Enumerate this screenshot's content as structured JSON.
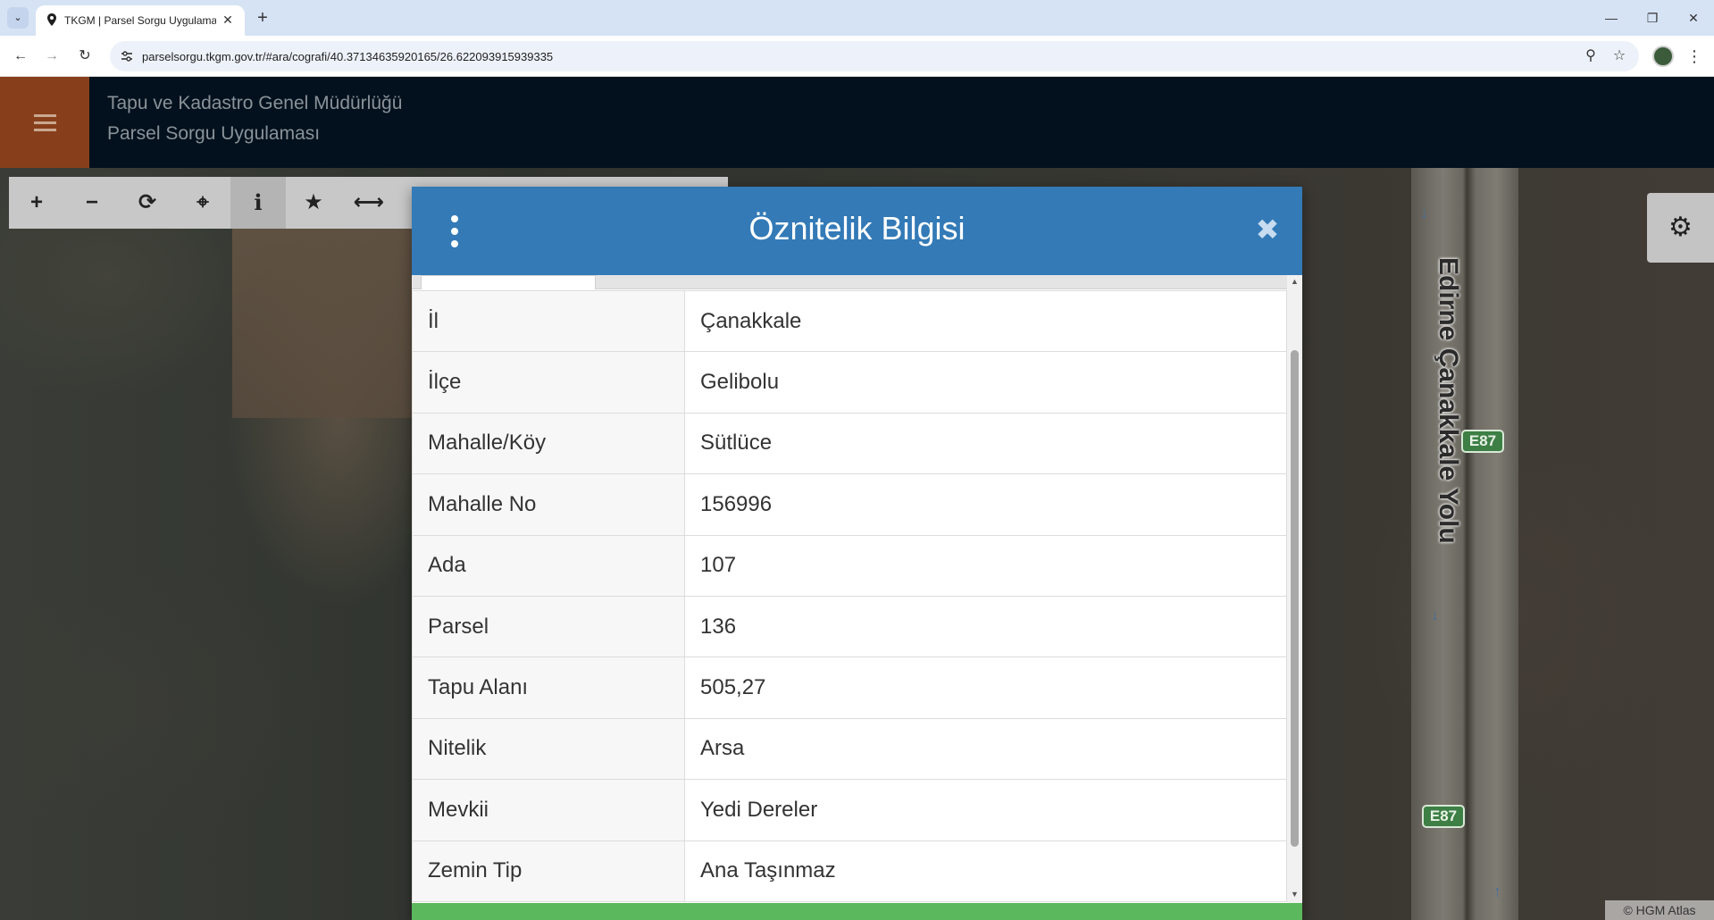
{
  "browser": {
    "tab_title": "TKGM | Parsel Sorgu Uygulaması",
    "url": "parselsorgu.tkgm.gov.tr/#ara/cografi/40.37134635920165/26.622093915939335",
    "icons": {
      "tab_search": "chevron-down-icon",
      "favicon": "location-pin-icon",
      "close_tab": "close-icon",
      "new_tab": "plus-icon",
      "back": "back-arrow-icon",
      "forward": "forward-arrow-icon",
      "reload": "reload-icon",
      "site_info": "site-settings-icon",
      "zoom": "zoom-icon",
      "bookmark": "star-outline-icon",
      "menu": "kebab-menu-icon"
    }
  },
  "app": {
    "title_line1": "Tapu ve Kadastro Genel Müdürlüğü",
    "title_line2": "Parsel Sorgu Uygulaması",
    "accent_color": "#873f1b",
    "header_color": "#02111d"
  },
  "toolbar": {
    "tools": [
      {
        "name": "zoom-in",
        "glyph": "+"
      },
      {
        "name": "zoom-out",
        "glyph": "−"
      },
      {
        "name": "refresh",
        "glyph": "⟳"
      },
      {
        "name": "locate",
        "glyph": "⌖"
      },
      {
        "name": "info",
        "glyph": "i"
      },
      {
        "name": "favorite",
        "glyph": "★"
      },
      {
        "name": "measure",
        "glyph": "⟷"
      }
    ],
    "settings_glyph": "⚙"
  },
  "map": {
    "road_name": "Edirne Çanakkale Yolu",
    "shield_1": "E87",
    "shield_2": "E87",
    "attribution": "© HGM Atlas"
  },
  "dialog": {
    "title": "Öznitelik Bilgisi",
    "close_glyph": "✖",
    "header_color": "#337ab7",
    "footer_color": "#5cb85c",
    "rows": [
      {
        "key": "İl",
        "value": "Çanakkale"
      },
      {
        "key": "İlçe",
        "value": "Gelibolu"
      },
      {
        "key": "Mahalle/Köy",
        "value": "Sütlüce"
      },
      {
        "key": "Mahalle No",
        "value": "156996"
      },
      {
        "key": "Ada",
        "value": "107"
      },
      {
        "key": "Parsel",
        "value": "136"
      },
      {
        "key": "Tapu Alanı",
        "value": "505,27"
      },
      {
        "key": "Nitelik",
        "value": "Arsa"
      },
      {
        "key": "Mevkii",
        "value": "Yedi Dereler"
      },
      {
        "key": "Zemin Tip",
        "value": "Ana Taşınmaz"
      }
    ]
  }
}
